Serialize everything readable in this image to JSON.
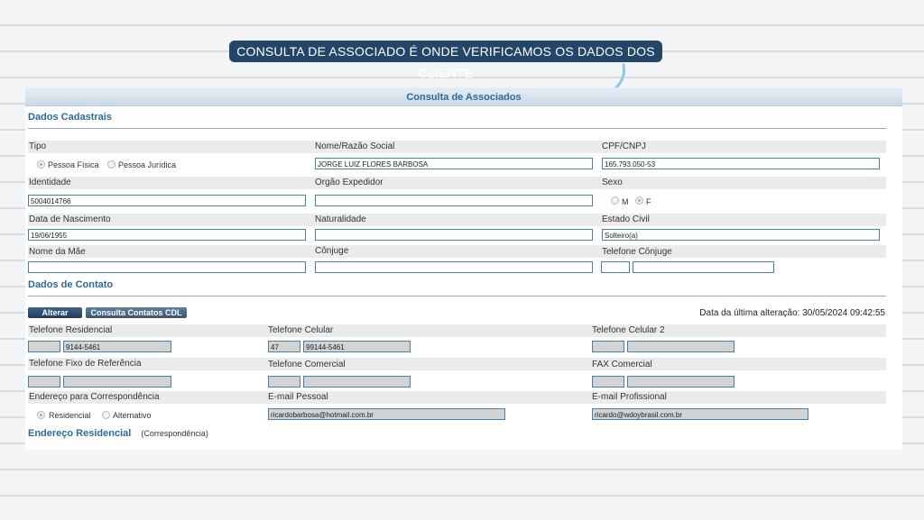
{
  "banner": "CONSULTA DE ASSOCIADO É ONDE VERIFICAMOS OS DADOS DOS CLIENTE",
  "panel_title": "Consulta de Associados",
  "cadastrais": {
    "section": "Dados Cadastrais",
    "tipo_label": "Tipo",
    "tipo_pf": "Pessoa Física",
    "tipo_pj": "Pessoa Jurídica",
    "nome_label": "Nome/Razão Social",
    "nome_value": "JORGE LUIZ FLORES BARBOSA",
    "cpf_label": "CPF/CNPJ",
    "cpf_value": "165.793.050-53",
    "identidade_label": "Identidade",
    "identidade_value": "5004014766",
    "orgao_label": "Orgão Expedidor",
    "orgao_value": "",
    "sexo_label": "Sexo",
    "sexo_m": "M",
    "sexo_f": "F",
    "nascimento_label": "Data de Nascimento",
    "nascimento_value": "19/06/1955",
    "naturalidade_label": "Naturalidade",
    "naturalidade_value": "",
    "estado_civil_label": "Estado Civil",
    "estado_civil_value": "Solteiro(a)",
    "mae_label": "Nome da Mãe",
    "mae_value": "",
    "conjuge_label": "Cônjuge",
    "conjuge_value": "",
    "tel_conjuge_label": "Telefone Cônjuge",
    "tel_conjuge_ddd": "",
    "tel_conjuge_num": ""
  },
  "contato": {
    "section": "Dados de Contato",
    "alterar_btn": "Alterar",
    "cdl_btn": "Consulta Contatos CDL",
    "ultima_alteracao_label": "Data da última alteração:",
    "ultima_alteracao_value": "30/05/2024 09:42:55",
    "tel_res_label": "Telefone Residencial",
    "tel_res_ddd": "",
    "tel_res_num": "9144-5461",
    "tel_cel_label": "Telefone Celular",
    "tel_cel_ddd": "47",
    "tel_cel_num": "99144-5461",
    "tel_cel2_label": "Telefone Celular 2",
    "tel_cel2_ddd": "",
    "tel_cel2_num": "",
    "tel_ref_label": "Telefone Fixo de Referência",
    "tel_ref_ddd": "",
    "tel_ref_num": "",
    "tel_com_label": "Telefone Comercial",
    "tel_com_ddd": "",
    "tel_com_num": "",
    "fax_label": "FAX Comercial",
    "fax_ddd": "",
    "fax_num": "",
    "end_corr_label": "Endereço para Correspondência",
    "end_res": "Residencial",
    "end_alt": "Alternativo",
    "email_pessoal_label": "E-mail Pessoal",
    "email_pessoal_value": "ricardobarbosa@hotmail.com.br",
    "email_prof_label": "E-mail Profissional",
    "email_prof_value": "ricardo@wdoybrasil.com.br"
  },
  "residencial": {
    "section": "Endereço Residencial",
    "note": "(Correspondência)"
  }
}
